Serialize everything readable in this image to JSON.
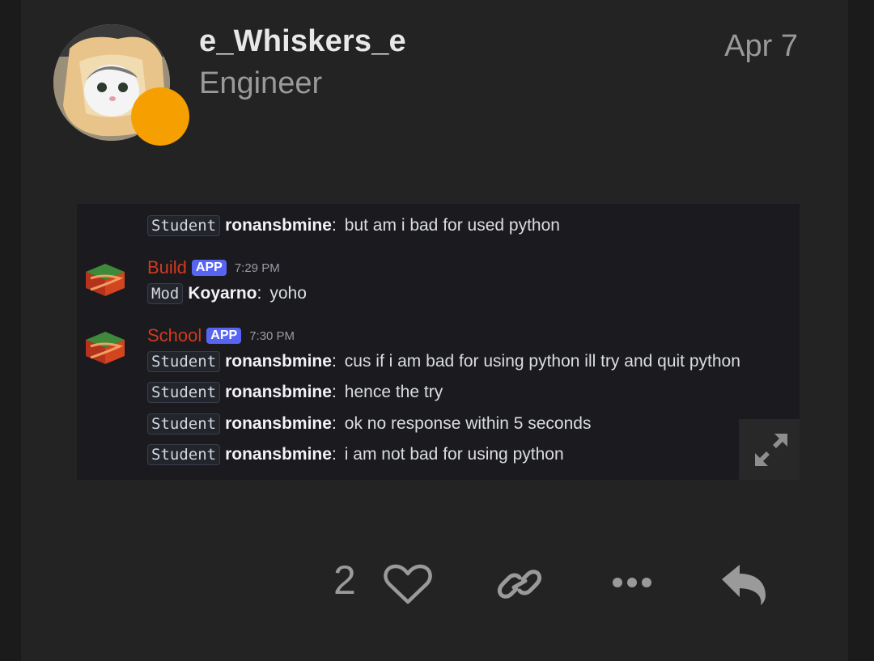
{
  "post": {
    "username": "e_Whiskers_e",
    "user_title": "Engineer",
    "date": "Apr 7",
    "status_color": "#f5a000"
  },
  "screenshot": {
    "rows": [
      {
        "role": "Student",
        "nick": "ronansbmine",
        "text": "but am i bad for used python"
      }
    ],
    "groups": [
      {
        "bot": "Build",
        "badge": "APP",
        "time": "7:29 PM",
        "icon": "server-logo-icon",
        "rows": [
          {
            "role": "Mod",
            "nick": "Koyarno",
            "text": "yoho"
          }
        ]
      },
      {
        "bot": "School",
        "badge": "APP",
        "time": "7:30 PM",
        "icon": "server-logo-icon",
        "rows": [
          {
            "role": "Student",
            "nick": "ronansbmine",
            "text": "cus if i am bad for using python ill try and quit python"
          },
          {
            "role": "Student",
            "nick": "ronansbmine",
            "text": "hence the try"
          },
          {
            "role": "Student",
            "nick": "ronansbmine",
            "text": "ok no response within 5 seconds"
          },
          {
            "role": "Student",
            "nick": "ronansbmine",
            "text": "i am not bad for using python"
          }
        ]
      }
    ],
    "colon": ":"
  },
  "actions": {
    "like_count": "2",
    "icons": [
      "heart-icon",
      "link-icon",
      "more-icon",
      "reply-icon"
    ]
  },
  "colors": {
    "bot_name": "#d23a1f",
    "app_badge": "#5865f2",
    "icon": "#9a9a9a"
  }
}
